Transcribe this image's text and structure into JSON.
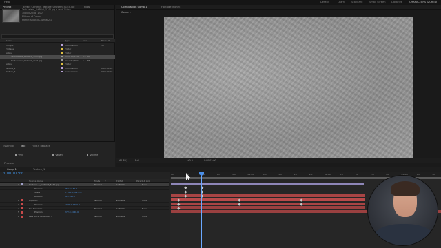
{
  "menubar": {
    "items": [
      "Help"
    ],
    "workspaces": [
      "Default",
      "Learn",
      "Standard",
      "Small Screen",
      "Libraries",
      "CHARACTERS & CREDIT"
    ]
  },
  "project": {
    "tabs": [
      "Project",
      "Effect Controls Texture_Uniform_5145.jpg",
      "Flow"
    ],
    "info": [
      "Texturelabs_InkPaint_5145.jpg ▾ used 1 time",
      "3080 x 2048 (1.00)",
      "",
      "Millions of Colors",
      "",
      "Profile: sRGB IEC61966-2.1"
    ],
    "columns": [
      "Name",
      "Type",
      "Size",
      "Frame R..."
    ],
    "rows": [
      {
        "name": "Comp 1",
        "type": "Composition",
        "size": "",
        "rate": "30",
        "color": "#b8a2d8"
      },
      {
        "name": "Footage",
        "type": "Folder",
        "size": "",
        "rate": "",
        "color": "#e0c040"
      },
      {
        "name": "Solids",
        "type": "Folder",
        "size": "",
        "rate": "",
        "color": "#e0c040"
      },
      {
        "name": "Texturelabs_InkPaint_5145.jpg",
        "type": "ImporterJPEG",
        "size": "1.1 MB",
        "rate": "",
        "color": "#9a9a9a",
        "selected": true
      },
      {
        "name": "Texturelabs_InkPaint_3141.jpg",
        "type": "ImporterJPEG",
        "size": "1.1 MB",
        "rate": "",
        "color": "#9a9a9a"
      },
      {
        "name": "Solids",
        "type": "Folder",
        "size": "",
        "rate": "",
        "color": "#e0c040"
      },
      {
        "name": "Texture_1",
        "type": "Composition",
        "size": "",
        "rate": "0:00:00:03",
        "color": "#b8a2d8"
      },
      {
        "name": "Texture_2",
        "type": "Composition",
        "size": "",
        "rate": "0:00:00:03",
        "color": "#b8a2d8"
      }
    ]
  },
  "effects": {
    "tabs": [
      "Essential",
      "Text",
      "Find & Replace"
    ],
    "options": [
      "Vivid",
      "Variant",
      "Volume"
    ],
    "footer": "Preview"
  },
  "viewer": {
    "tabs": [
      "Composition Comp 1",
      "Footage (none)"
    ],
    "subtab": "Comp 1",
    "bottom": [
      "(62.8%)",
      "Full",
      "0:00:01:00",
      "+0.0",
      "Active Camera",
      "1 View"
    ]
  },
  "timeline": {
    "tabs": [
      "Comp 1",
      "Texture_1"
    ],
    "timecode": "0:00:01:00",
    "columns": [
      "Source Name",
      "Mode",
      "T",
      "TrkMat",
      "Parent & Link"
    ],
    "ruler": [
      "00f",
      "05f",
      "10f",
      "15f",
      "20f",
      "01:00f",
      "05f",
      "10f",
      "15f",
      "20f",
      "02:00f",
      "05f",
      "10f",
      "15f",
      "20f",
      "03:00f",
      "05f",
      "10f"
    ],
    "layers": [
      {
        "num": "1",
        "name": "Texturel...._InkPaint_5145.jpg",
        "mode": "Normal",
        "trk": "No Matte",
        "parent": "None",
        "color": "#a0a0c8",
        "selected": true
      },
      {
        "num": "",
        "name": "Position",
        "value": "960.0,540.0",
        "color": ""
      },
      {
        "num": "",
        "name": "Scale",
        "value": "∞ 102.0,102.0%",
        "color": ""
      },
      {
        "num": "",
        "name": "Rotation",
        "value": "0x+198.0°",
        "color": ""
      },
      {
        "num": "2",
        "name": "Adjustm.",
        "mode": "Normal",
        "trk": "No Matte",
        "parent": "None",
        "color": "#c84a4a"
      },
      {
        "num": "3",
        "name": "Position",
        "value": "1970.0,1290.0",
        "color": "#c84a4a"
      },
      {
        "num": "4",
        "name": "Set Direction",
        "mode": "Normal",
        "trk": "No Matte",
        "parent": "None",
        "color": "#c84a4a"
      },
      {
        "num": "5",
        "name": "Position",
        "value": "272.0,1026.0",
        "color": "#c84a4a"
      },
      {
        "num": "6",
        "name": "Pale Royal Blue Solid 2",
        "mode": "Normal",
        "trk": "No Matte",
        "parent": "None",
        "color": "#c84a4a"
      }
    ]
  }
}
